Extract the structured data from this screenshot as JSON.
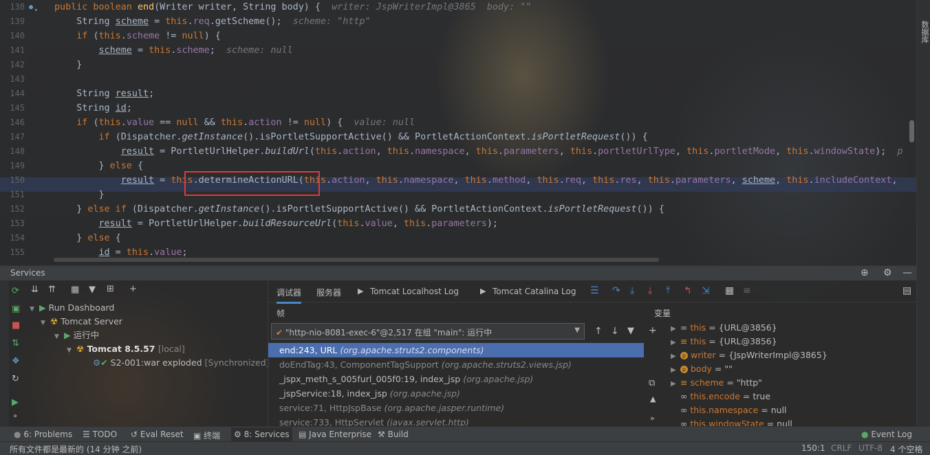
{
  "editor": {
    "lines": [
      {
        "n": "138",
        "html": "<span class='k'>public boolean </span><span class='mt'>end</span>(Writer writer, String body) {  <span class='hint'>writer: JspWriterImpl@3865  body: \"\"</span>"
      },
      {
        "n": "139",
        "html": "    String <span class='u'>scheme</span> = <span class='k'>this</span>.<span class='f'>req</span>.getScheme();  <span class='hint'>scheme: \"http\"</span>"
      },
      {
        "n": "140",
        "html": "    <span class='k'>if </span>(<span class='k'>this</span>.<span class='f'>scheme</span> != <span class='k'>null</span>) {"
      },
      {
        "n": "141",
        "html": "        <span class='u'>scheme</span> = <span class='k'>this</span>.<span class='f'>scheme</span>;  <span class='hint'>scheme: null</span>"
      },
      {
        "n": "142",
        "html": "    }"
      },
      {
        "n": "143",
        "html": ""
      },
      {
        "n": "144",
        "html": "    String <span class='u'>result</span>;"
      },
      {
        "n": "145",
        "html": "    String <span class='u'>id</span>;"
      },
      {
        "n": "146",
        "html": "    <span class='k'>if </span>(<span class='k'>this</span>.<span class='f'>value</span> == <span class='k'>null </span>&amp;&amp; <span class='k'>this</span>.<span class='f'>action</span> != <span class='k'>null</span>) {  <span class='hint'>value: null</span>"
      },
      {
        "n": "147",
        "html": "        <span class='k'>if </span>(Dispatcher.<span class='i'>getInstance</span>().isPortletSupportActive() &amp;&amp; PortletActionContext.<span class='i'>isPortletRequest</span>()) {"
      },
      {
        "n": "148",
        "html": "            <span class='u'>result</span> = PortletUrlHelper.<span class='i'>buildUrl</span>(<span class='k'>this</span>.<span class='f'>action</span>, <span class='k'>this</span>.<span class='f'>namespace</span>, <span class='k'>this</span>.<span class='f'>parameters</span>, <span class='k'>this</span>.<span class='f'>portletUrlType</span>, <span class='k'>this</span>.<span class='f'>portletMode</span>, <span class='k'>this</span>.<span class='f'>windowState</span>);  <span class='hint'>p</span>"
      },
      {
        "n": "149",
        "html": "        } <span class='k'>else </span>{"
      },
      {
        "n": "150",
        "html": "            <span class='u'>result</span> = <span class='k'>this</span>.determineActionURL(<span class='k'>this</span>.<span class='f'>action</span>, <span class='k'>this</span>.<span class='f'>namespace</span>, <span class='k'>this</span>.<span class='f'>method</span>, <span class='k'>this</span>.<span class='f'>req</span>, <span class='k'>this</span>.<span class='f'>res</span>, <span class='k'>this</span>.<span class='f'>parameters</span>, <span class='u'>scheme</span>, <span class='k'>this</span>.<span class='f'>includeContext</span>,"
      },
      {
        "n": "151",
        "html": "        }"
      },
      {
        "n": "152",
        "html": "    } <span class='k'>else if </span>(Dispatcher.<span class='i'>getInstance</span>().isPortletSupportActive() &amp;&amp; PortletActionContext.<span class='i'>isPortletRequest</span>()) {"
      },
      {
        "n": "153",
        "html": "        <span class='u'>result</span> = PortletUrlHelper.<span class='i'>buildResourceUrl</span>(<span class='k'>this</span>.<span class='f'>value</span>, <span class='k'>this</span>.<span class='f'>parameters</span>);"
      },
      {
        "n": "154",
        "html": "    } <span class='k'>else </span>{"
      },
      {
        "n": "155",
        "html": "        <span class='u'>id</span> = <span class='k'>this</span>.<span class='f'>value</span>;"
      }
    ]
  },
  "right_strip": {
    "label": "数据库"
  },
  "services": {
    "title": "Services",
    "tree": [
      {
        "label": "Run Dashboard"
      },
      {
        "label": "Tomcat Server"
      },
      {
        "label": "运行中"
      },
      {
        "label": "Tomcat 8.5.57",
        "suffix": "[local]"
      },
      {
        "label": "S2-001:war exploded",
        "suffix": "[Synchronized]"
      }
    ]
  },
  "debugger": {
    "tabs": [
      "调试器",
      "服务器",
      "Tomcat Localhost Log",
      "Tomcat Catalina Log"
    ],
    "frames_title": "帧",
    "variables_title": "变量",
    "thread": "\"http-nio-8081-exec-6\"@2,517 在组 \"main\": 运行中",
    "frames": [
      {
        "method": "end:243, URL",
        "pkg": "(org.apache.struts2.components)"
      },
      {
        "method": "doEndTag:43, ComponentTagSupport",
        "pkg": "(org.apache.struts2.views.jsp)"
      },
      {
        "method": "_jspx_meth_s_005furl_005f0:19, index_jsp",
        "pkg": "(org.apache.jsp)"
      },
      {
        "method": "_jspService:18, index_jsp",
        "pkg": "(org.apache.jsp)"
      },
      {
        "method": "service:71, HttpJspBase",
        "pkg": "(org.apache.jasper.runtime)"
      },
      {
        "method": "service:733, HttpServlet",
        "pkg": "(javax.servlet.http)"
      }
    ],
    "variables": [
      {
        "name": "this",
        "value": "= {URL@3856}"
      },
      {
        "name": "this",
        "value": "= {URL@3856}"
      },
      {
        "name": "writer",
        "value": "= {JspWriterImpl@3865}"
      },
      {
        "name": "body",
        "value": "= \"\""
      },
      {
        "name": "scheme",
        "value": "= \"http\""
      },
      {
        "name": "this.encode",
        "value": "= true"
      },
      {
        "name": "this.namespace",
        "value": "= null"
      },
      {
        "name": "this.windowState",
        "value": "= null"
      }
    ]
  },
  "toolwindows": {
    "problems": "6: Problems",
    "todo": "TODO",
    "eval": "Eval Reset",
    "terminal": "终端",
    "services": "8: Services",
    "java_ee": "Java Enterprise",
    "build": "Build",
    "event_log": "Event Log"
  },
  "status": {
    "message": "所有文件都是最新的 (14 分钟 之前)",
    "position": "150:1",
    "line_sep": "CRLF",
    "encoding": "UTF-8",
    "indent": "4 个空格"
  }
}
